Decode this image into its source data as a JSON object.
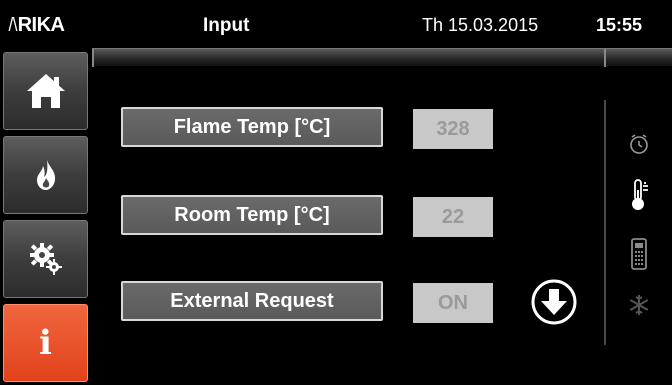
{
  "header": {
    "logo_text": "RIKA",
    "title": "Input",
    "date": "Th 15.03.2015",
    "time": "15:55"
  },
  "nav": {
    "items": [
      {
        "name": "home",
        "icon": "home-icon",
        "active": false
      },
      {
        "name": "flame",
        "icon": "flame-icon",
        "active": false
      },
      {
        "name": "settings",
        "icon": "gears-icon",
        "active": false
      },
      {
        "name": "info",
        "icon": "info-icon",
        "active": true,
        "label": "i"
      }
    ]
  },
  "main": {
    "rows": [
      {
        "label": "Flame Temp [°C]",
        "value": "328"
      },
      {
        "label": "Room Temp [°C]",
        "value": "22"
      },
      {
        "label": "External Request",
        "value": "ON"
      }
    ]
  },
  "side_icons": [
    "clock-icon",
    "thermometer-icon",
    "remote-icon",
    "snowflake-icon"
  ],
  "colors": {
    "accent": "#e8491f",
    "button_gray": "#5f5f5f",
    "value_bg": "#c8c8c8",
    "value_text": "#9a9a9a"
  }
}
